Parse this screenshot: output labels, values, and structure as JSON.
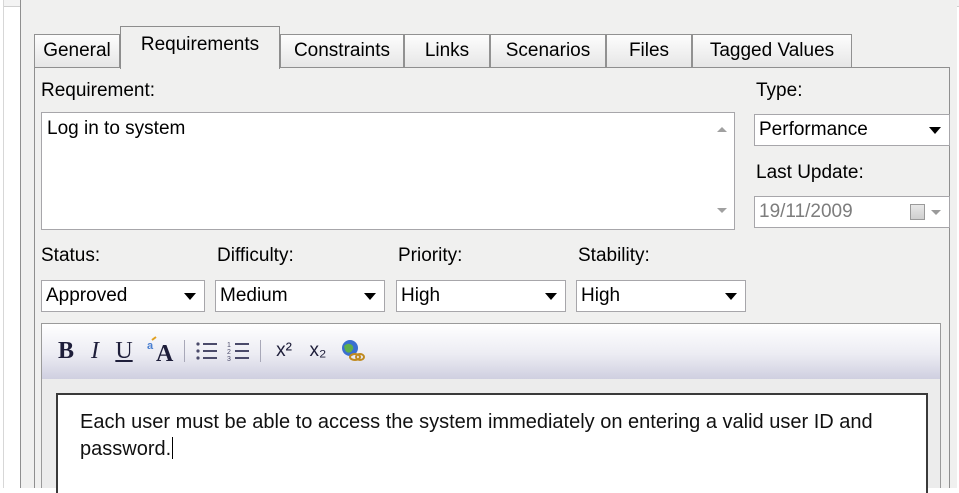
{
  "tabs": [
    "General",
    "Requirements",
    "Constraints",
    "Links",
    "Scenarios",
    "Files",
    "Tagged Values"
  ],
  "active_tab": "Requirements",
  "requirement": {
    "label": "Requirement:",
    "value": "Log in to system"
  },
  "type": {
    "label": "Type:",
    "value": "Performance"
  },
  "last_update": {
    "label": "Last Update:",
    "value": "19/11/2009"
  },
  "status": {
    "label": "Status:",
    "value": "Approved"
  },
  "difficulty": {
    "label": "Difficulty:",
    "value": "Medium"
  },
  "priority": {
    "label": "Priority:",
    "value": "High"
  },
  "stability": {
    "label": "Stability:",
    "value": "High"
  },
  "toolbar": {
    "bold": "B",
    "italic": "I",
    "underline": "U",
    "font_color": "A",
    "superscript": "x²",
    "subscript": "x₂"
  },
  "notes": {
    "text": "Each user must be able to access the system immediately on entering a valid user ID and password."
  },
  "icons": [
    "scroll-up-icon",
    "scroll-down-icon",
    "dropdown-arrow-icon",
    "calendar-icon",
    "font-color-icon",
    "bullet-list-icon",
    "numbered-list-icon",
    "hyperlink-icon"
  ]
}
